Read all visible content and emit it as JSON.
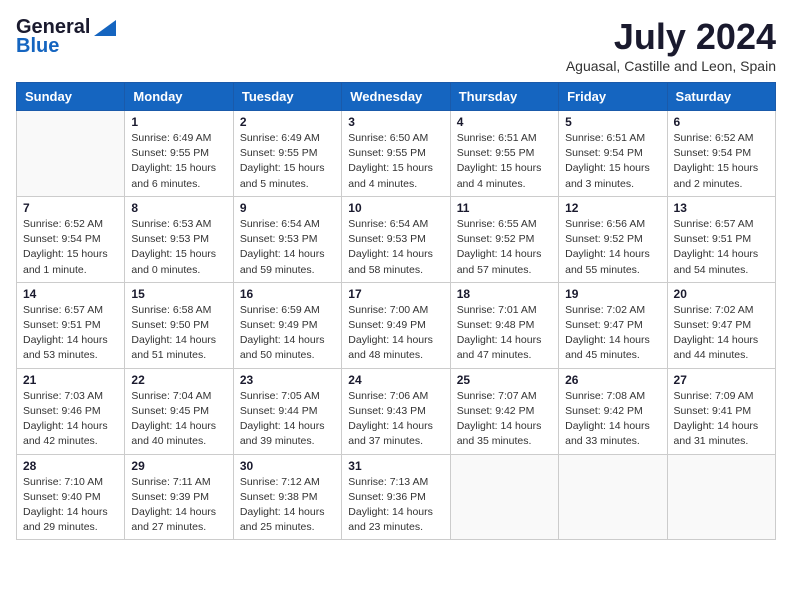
{
  "logo": {
    "general": "General",
    "blue": "Blue"
  },
  "header": {
    "month": "July 2024",
    "location": "Aguasal, Castille and Leon, Spain"
  },
  "weekdays": [
    "Sunday",
    "Monday",
    "Tuesday",
    "Wednesday",
    "Thursday",
    "Friday",
    "Saturday"
  ],
  "weeks": [
    [
      {
        "day": "",
        "lines": []
      },
      {
        "day": "1",
        "lines": [
          "Sunrise: 6:49 AM",
          "Sunset: 9:55 PM",
          "Daylight: 15 hours",
          "and 6 minutes."
        ]
      },
      {
        "day": "2",
        "lines": [
          "Sunrise: 6:49 AM",
          "Sunset: 9:55 PM",
          "Daylight: 15 hours",
          "and 5 minutes."
        ]
      },
      {
        "day": "3",
        "lines": [
          "Sunrise: 6:50 AM",
          "Sunset: 9:55 PM",
          "Daylight: 15 hours",
          "and 4 minutes."
        ]
      },
      {
        "day": "4",
        "lines": [
          "Sunrise: 6:51 AM",
          "Sunset: 9:55 PM",
          "Daylight: 15 hours",
          "and 4 minutes."
        ]
      },
      {
        "day": "5",
        "lines": [
          "Sunrise: 6:51 AM",
          "Sunset: 9:54 PM",
          "Daylight: 15 hours",
          "and 3 minutes."
        ]
      },
      {
        "day": "6",
        "lines": [
          "Sunrise: 6:52 AM",
          "Sunset: 9:54 PM",
          "Daylight: 15 hours",
          "and 2 minutes."
        ]
      }
    ],
    [
      {
        "day": "7",
        "lines": [
          "Sunrise: 6:52 AM",
          "Sunset: 9:54 PM",
          "Daylight: 15 hours",
          "and 1 minute."
        ]
      },
      {
        "day": "8",
        "lines": [
          "Sunrise: 6:53 AM",
          "Sunset: 9:53 PM",
          "Daylight: 15 hours",
          "and 0 minutes."
        ]
      },
      {
        "day": "9",
        "lines": [
          "Sunrise: 6:54 AM",
          "Sunset: 9:53 PM",
          "Daylight: 14 hours",
          "and 59 minutes."
        ]
      },
      {
        "day": "10",
        "lines": [
          "Sunrise: 6:54 AM",
          "Sunset: 9:53 PM",
          "Daylight: 14 hours",
          "and 58 minutes."
        ]
      },
      {
        "day": "11",
        "lines": [
          "Sunrise: 6:55 AM",
          "Sunset: 9:52 PM",
          "Daylight: 14 hours",
          "and 57 minutes."
        ]
      },
      {
        "day": "12",
        "lines": [
          "Sunrise: 6:56 AM",
          "Sunset: 9:52 PM",
          "Daylight: 14 hours",
          "and 55 minutes."
        ]
      },
      {
        "day": "13",
        "lines": [
          "Sunrise: 6:57 AM",
          "Sunset: 9:51 PM",
          "Daylight: 14 hours",
          "and 54 minutes."
        ]
      }
    ],
    [
      {
        "day": "14",
        "lines": [
          "Sunrise: 6:57 AM",
          "Sunset: 9:51 PM",
          "Daylight: 14 hours",
          "and 53 minutes."
        ]
      },
      {
        "day": "15",
        "lines": [
          "Sunrise: 6:58 AM",
          "Sunset: 9:50 PM",
          "Daylight: 14 hours",
          "and 51 minutes."
        ]
      },
      {
        "day": "16",
        "lines": [
          "Sunrise: 6:59 AM",
          "Sunset: 9:49 PM",
          "Daylight: 14 hours",
          "and 50 minutes."
        ]
      },
      {
        "day": "17",
        "lines": [
          "Sunrise: 7:00 AM",
          "Sunset: 9:49 PM",
          "Daylight: 14 hours",
          "and 48 minutes."
        ]
      },
      {
        "day": "18",
        "lines": [
          "Sunrise: 7:01 AM",
          "Sunset: 9:48 PM",
          "Daylight: 14 hours",
          "and 47 minutes."
        ]
      },
      {
        "day": "19",
        "lines": [
          "Sunrise: 7:02 AM",
          "Sunset: 9:47 PM",
          "Daylight: 14 hours",
          "and 45 minutes."
        ]
      },
      {
        "day": "20",
        "lines": [
          "Sunrise: 7:02 AM",
          "Sunset: 9:47 PM",
          "Daylight: 14 hours",
          "and 44 minutes."
        ]
      }
    ],
    [
      {
        "day": "21",
        "lines": [
          "Sunrise: 7:03 AM",
          "Sunset: 9:46 PM",
          "Daylight: 14 hours",
          "and 42 minutes."
        ]
      },
      {
        "day": "22",
        "lines": [
          "Sunrise: 7:04 AM",
          "Sunset: 9:45 PM",
          "Daylight: 14 hours",
          "and 40 minutes."
        ]
      },
      {
        "day": "23",
        "lines": [
          "Sunrise: 7:05 AM",
          "Sunset: 9:44 PM",
          "Daylight: 14 hours",
          "and 39 minutes."
        ]
      },
      {
        "day": "24",
        "lines": [
          "Sunrise: 7:06 AM",
          "Sunset: 9:43 PM",
          "Daylight: 14 hours",
          "and 37 minutes."
        ]
      },
      {
        "day": "25",
        "lines": [
          "Sunrise: 7:07 AM",
          "Sunset: 9:42 PM",
          "Daylight: 14 hours",
          "and 35 minutes."
        ]
      },
      {
        "day": "26",
        "lines": [
          "Sunrise: 7:08 AM",
          "Sunset: 9:42 PM",
          "Daylight: 14 hours",
          "and 33 minutes."
        ]
      },
      {
        "day": "27",
        "lines": [
          "Sunrise: 7:09 AM",
          "Sunset: 9:41 PM",
          "Daylight: 14 hours",
          "and 31 minutes."
        ]
      }
    ],
    [
      {
        "day": "28",
        "lines": [
          "Sunrise: 7:10 AM",
          "Sunset: 9:40 PM",
          "Daylight: 14 hours",
          "and 29 minutes."
        ]
      },
      {
        "day": "29",
        "lines": [
          "Sunrise: 7:11 AM",
          "Sunset: 9:39 PM",
          "Daylight: 14 hours",
          "and 27 minutes."
        ]
      },
      {
        "day": "30",
        "lines": [
          "Sunrise: 7:12 AM",
          "Sunset: 9:38 PM",
          "Daylight: 14 hours",
          "and 25 minutes."
        ]
      },
      {
        "day": "31",
        "lines": [
          "Sunrise: 7:13 AM",
          "Sunset: 9:36 PM",
          "Daylight: 14 hours",
          "and 23 minutes."
        ]
      },
      {
        "day": "",
        "lines": []
      },
      {
        "day": "",
        "lines": []
      },
      {
        "day": "",
        "lines": []
      }
    ]
  ]
}
